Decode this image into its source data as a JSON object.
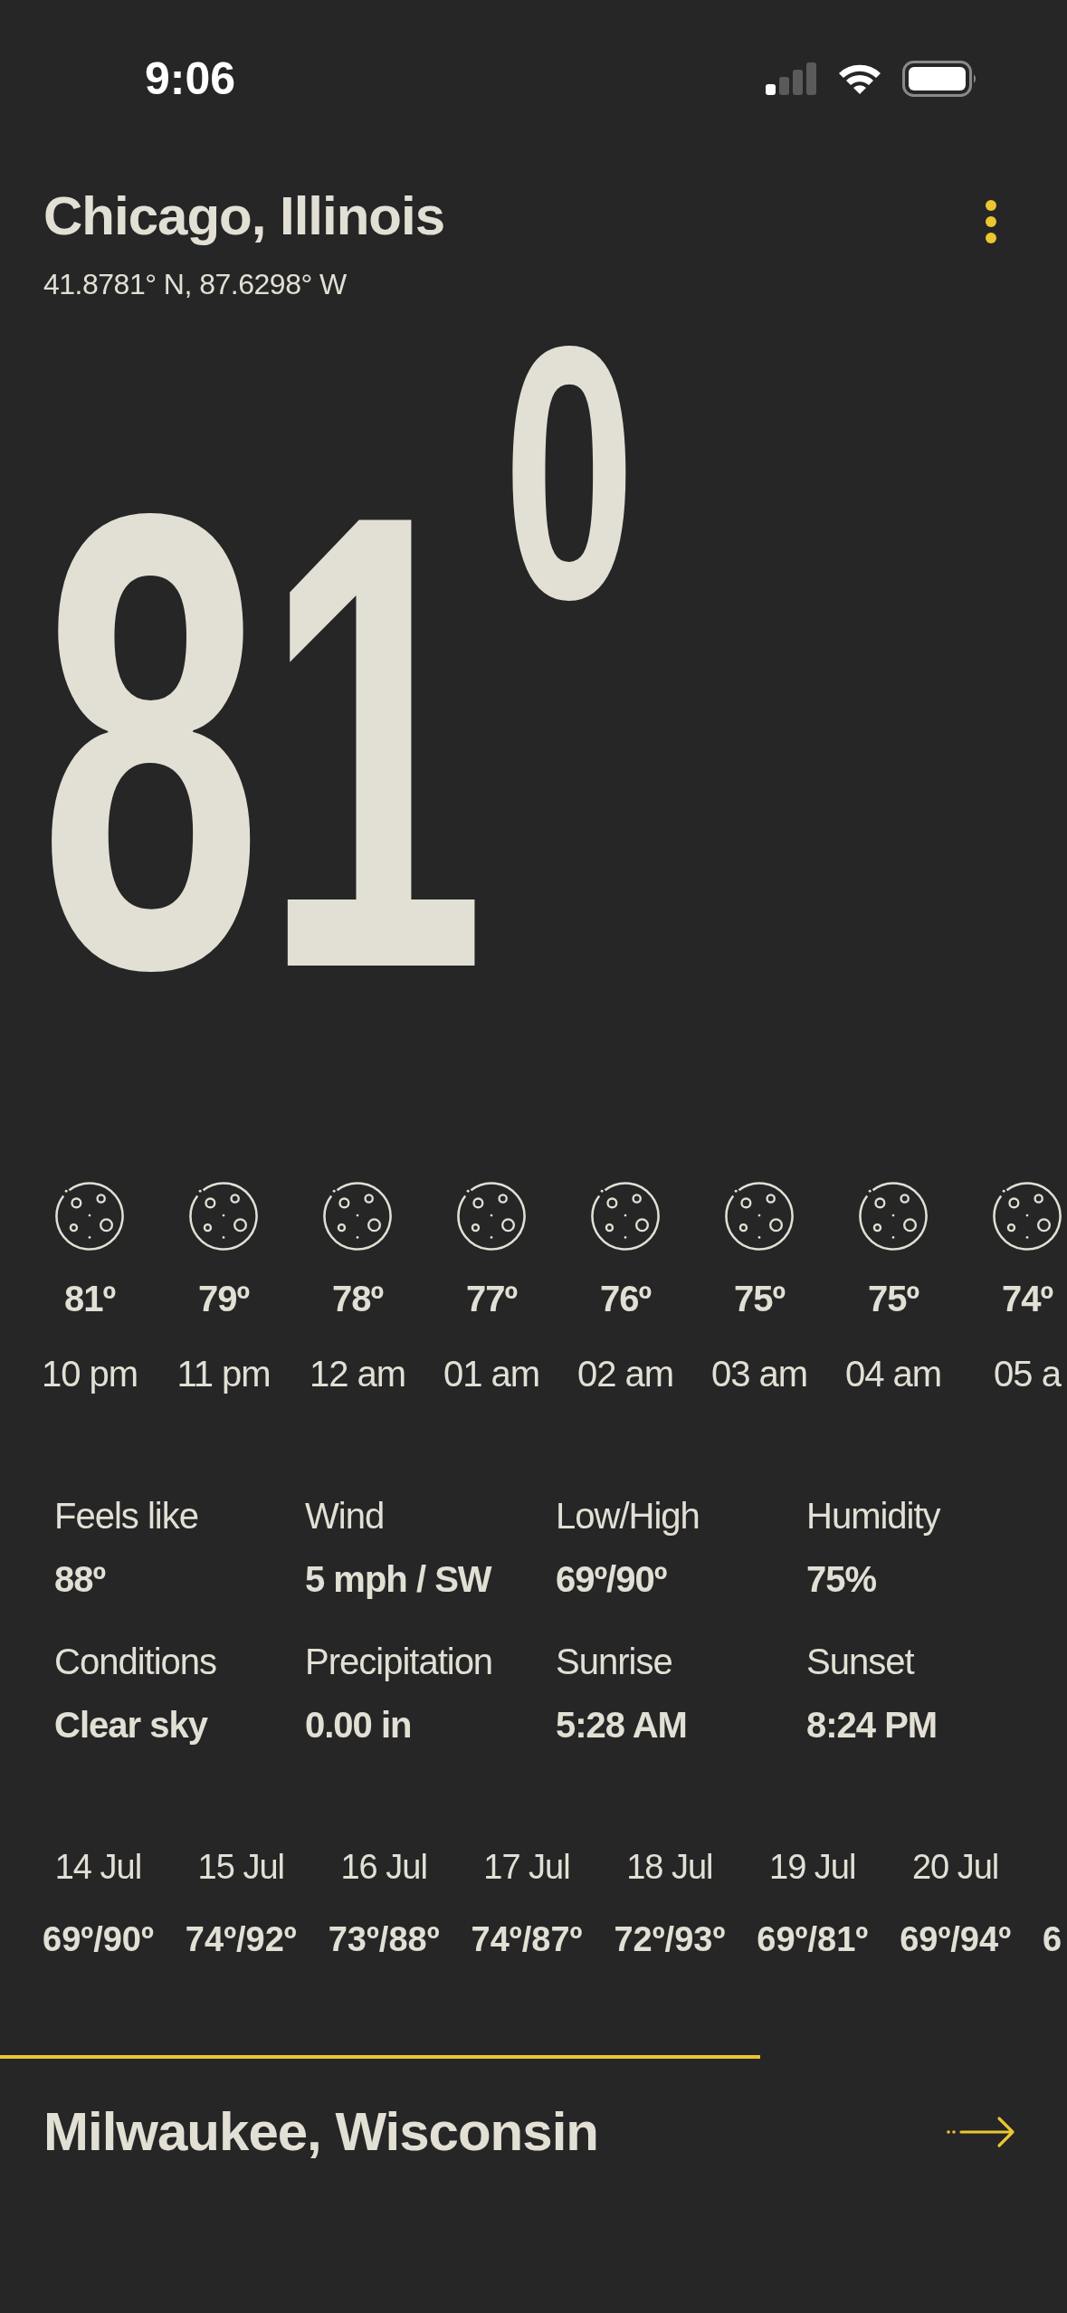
{
  "status_bar": {
    "time": "9:06"
  },
  "location": {
    "name": "Chicago, Illinois",
    "coordinates": "41.8781° N, 87.6298° W"
  },
  "current": {
    "temperature": "81",
    "degree": "0"
  },
  "hourly": [
    {
      "temp": "81º",
      "time": "10 pm"
    },
    {
      "temp": "79º",
      "time": "11 pm"
    },
    {
      "temp": "78º",
      "time": "12 am"
    },
    {
      "temp": "77º",
      "time": "01 am"
    },
    {
      "temp": "76º",
      "time": "02 am"
    },
    {
      "temp": "75º",
      "time": "03 am"
    },
    {
      "temp": "75º",
      "time": "04 am"
    },
    {
      "temp": "74º",
      "time": "05 a"
    }
  ],
  "details": [
    {
      "label": "Feels like",
      "value": "88º"
    },
    {
      "label": "Wind",
      "value": "5 mph / SW"
    },
    {
      "label": "Low/High",
      "value": "69º/90º"
    },
    {
      "label": "Humidity",
      "value": "75%"
    },
    {
      "label": "Conditions",
      "value": "Clear sky"
    },
    {
      "label": "Precipitation",
      "value": "0.00 in"
    },
    {
      "label": "Sunrise",
      "value": "5:28 AM"
    },
    {
      "label": "Sunset",
      "value": "8:24 PM"
    }
  ],
  "daily": [
    {
      "date": "14 Jul",
      "range": "69º/90º"
    },
    {
      "date": "15 Jul",
      "range": "74º/92º"
    },
    {
      "date": "16 Jul",
      "range": "73º/88º"
    },
    {
      "date": "17 Jul",
      "range": "74º/87º"
    },
    {
      "date": "18 Jul",
      "range": "72º/93º"
    },
    {
      "date": "19 Jul",
      "range": "69º/81º"
    },
    {
      "date": "20 Jul",
      "range": "69º/94º"
    },
    {
      "range": "6"
    }
  ],
  "next_location": {
    "name": "Milwaukee, Wisconsin"
  }
}
